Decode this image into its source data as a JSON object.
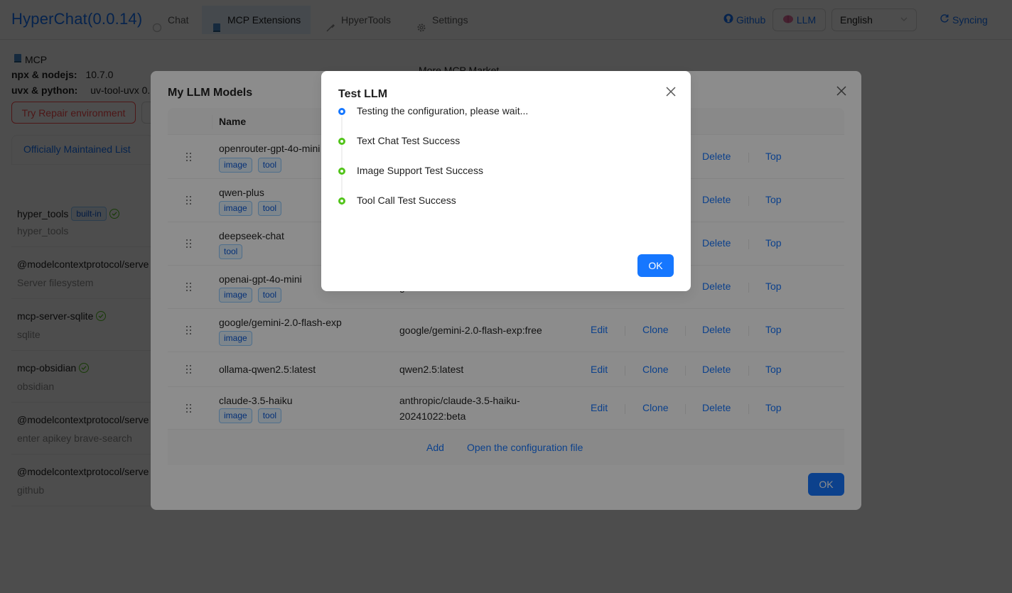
{
  "app": {
    "title": "HyperChat(0.0.14)"
  },
  "nav": {
    "chat": "Chat",
    "mcp_extensions": "MCP Extensions",
    "hyper_tools": "HpyerTools",
    "settings": "Settings"
  },
  "header_right": {
    "github": "Github",
    "llm": "LLM",
    "language": "English",
    "syncing": "Syncing"
  },
  "background": {
    "mcp_label": "MCP",
    "npx_label": "npx & nodejs:",
    "npx_value": "10.7.0",
    "uvx_label": "uvx & python:",
    "uvx_value": "uv-tool-uvx 0.",
    "repair_button": "Try Repair environment",
    "tab_official": "Officially Maintained List",
    "more_market": "More MCP Market",
    "items": [
      {
        "title": "hyper_tools",
        "badge": "built-in",
        "subtitle": "hyper_tools",
        "ok": true
      },
      {
        "title": "@modelcontextprotocol/serve",
        "subtitle": "Server filesystem"
      },
      {
        "title": "mcp-server-sqlite",
        "subtitle": "sqlite",
        "ok": true
      },
      {
        "title": "mcp-obsidian",
        "subtitle": "obsidian",
        "ok": true
      },
      {
        "title": "@modelcontextprotocol/serve",
        "subtitle": "enter apikey brave-search"
      },
      {
        "title": "@modelcontextprotocol/serve",
        "subtitle": "github"
      }
    ]
  },
  "llm_modal": {
    "title": "My LLM Models",
    "col_name": "Name",
    "actions": {
      "edit": "Edit",
      "clone": "Clone",
      "delete": "Delete",
      "top": "Top"
    },
    "rows": [
      {
        "name": "openrouter-gpt-4o-mini",
        "tags": [
          "image",
          "tool"
        ],
        "model": ""
      },
      {
        "name": "qwen-plus",
        "tags": [
          "image",
          "tool"
        ],
        "model": ""
      },
      {
        "name": "deepseek-chat",
        "tags": [
          "tool"
        ],
        "model": ""
      },
      {
        "name": "openai-gpt-4o-mini",
        "tags": [
          "image",
          "tool"
        ],
        "model": "g"
      },
      {
        "name": "google/gemini-2.0-flash-exp",
        "tags": [
          "image"
        ],
        "model": "google/gemini-2.0-flash-exp:free"
      },
      {
        "name": "ollama-qwen2.5:latest",
        "tags": [],
        "model": "qwen2.5:latest"
      },
      {
        "name": "claude-3.5-haiku",
        "tags": [
          "image",
          "tool"
        ],
        "model": "anthropic/claude-3.5-haiku-20241022:beta"
      }
    ],
    "footer": {
      "add": "Add",
      "open_config": "Open the configuration file"
    },
    "ok": "OK"
  },
  "test_modal": {
    "title": "Test LLM",
    "steps": [
      {
        "text": "Testing the configuration, please wait...",
        "status": "pending"
      },
      {
        "text": "Text Chat Test Success",
        "status": "success"
      },
      {
        "text": "Image Support Test Success",
        "status": "success"
      },
      {
        "text": "Tool Call Test Success",
        "status": "success"
      }
    ],
    "ok": "OK"
  },
  "colors": {
    "primary": "#1677ff",
    "success": "#52c41a",
    "danger": "#ff4d4f"
  }
}
